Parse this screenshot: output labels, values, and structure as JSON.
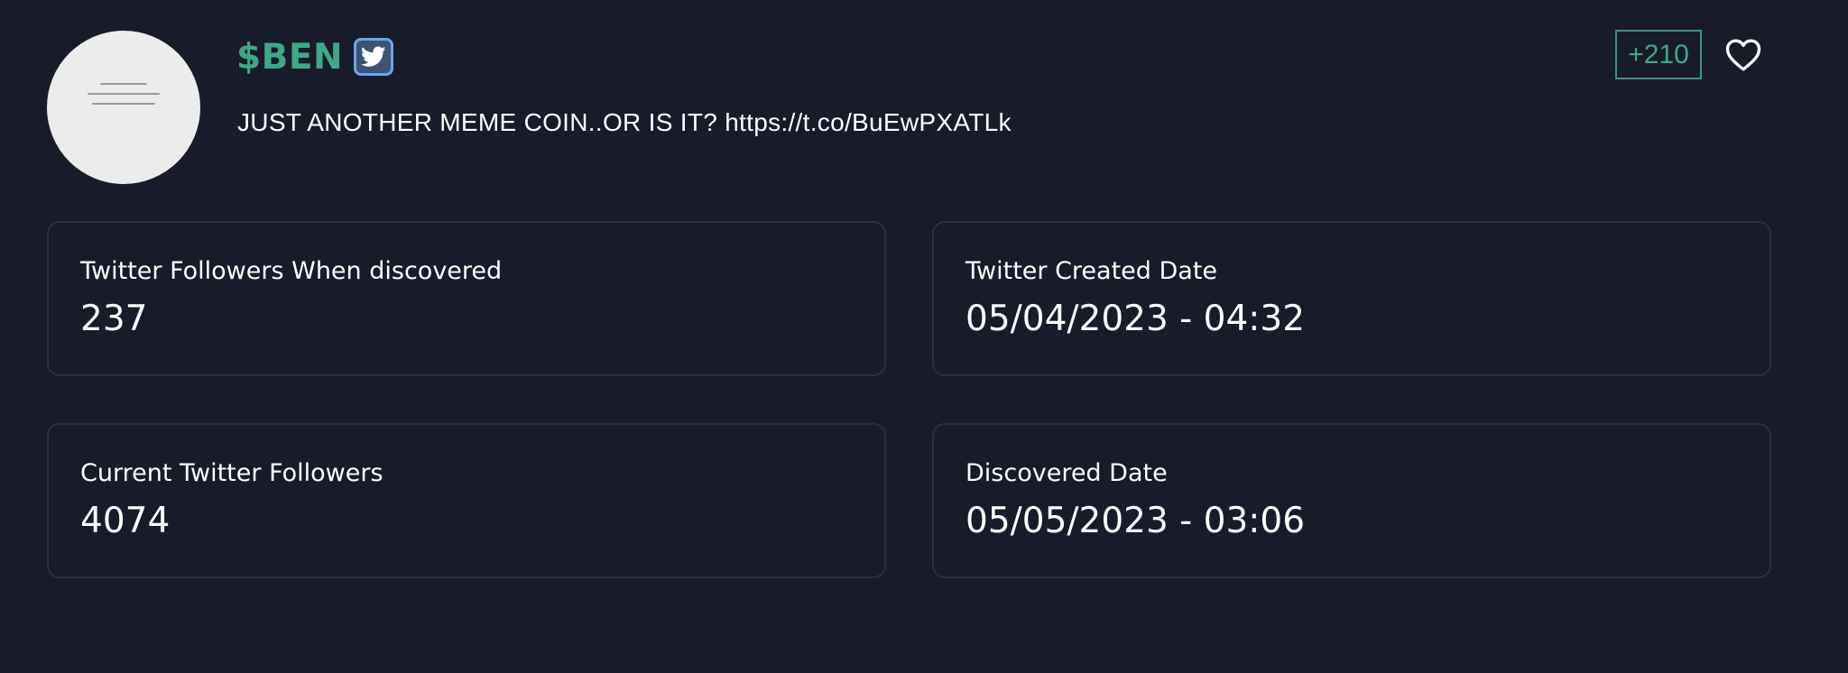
{
  "token": {
    "ticker": "$BEN",
    "description": "JUST ANOTHER MEME COIN..OR IS IT? https://t.co/BuEwPXATLk",
    "score": "+210",
    "avatar_icon": "token-avatar-image",
    "badge_icon": "twitter-icon",
    "favorite_icon": "heart-icon"
  },
  "stats": {
    "followers_discovered": {
      "label": "Twitter Followers When discovered",
      "value": "237"
    },
    "created_date": {
      "label": "Twitter Created Date",
      "value": "05/04/2023 - 04:32"
    },
    "current_followers": {
      "label": "Current Twitter Followers",
      "value": "4074"
    },
    "discovered_date": {
      "label": "Discovered Date",
      "value": "05/05/2023 - 03:06"
    }
  },
  "colors": {
    "background": "#181b29",
    "accent": "#3ea887",
    "card_border": "#2b2f40",
    "twitter_blue": "#6fa3e8"
  }
}
